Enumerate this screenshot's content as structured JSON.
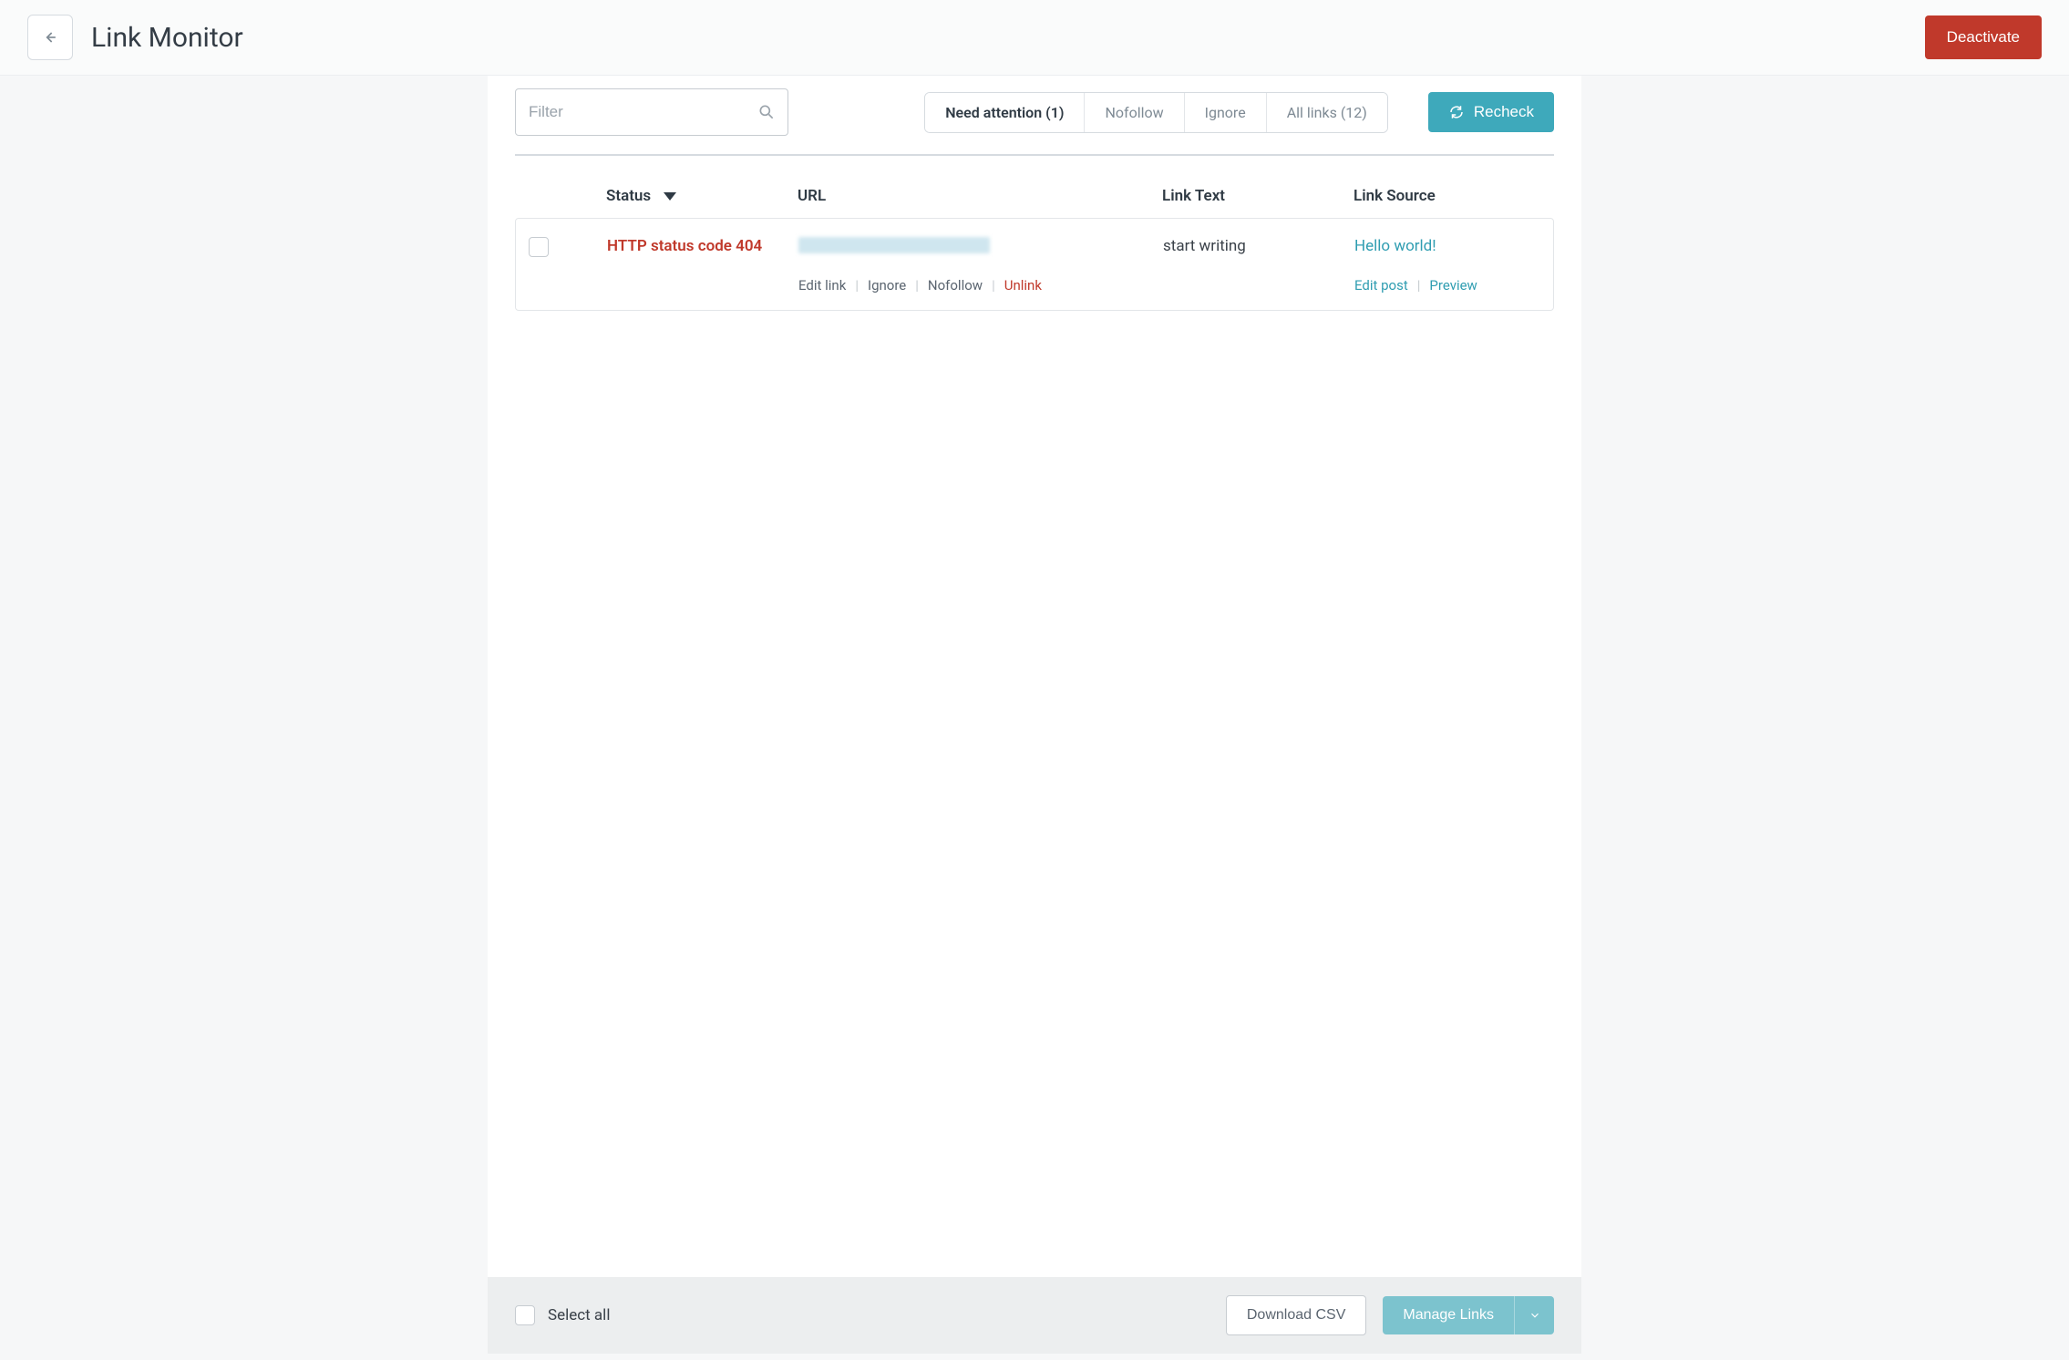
{
  "header": {
    "title": "Link Monitor",
    "deactivate_label": "Deactivate"
  },
  "toolbar": {
    "filter_placeholder": "Filter",
    "tabs": [
      {
        "label": "Need attention (1)",
        "active": true
      },
      {
        "label": "Nofollow",
        "active": false
      },
      {
        "label": "Ignore",
        "active": false
      },
      {
        "label": "All links (12)",
        "active": false
      }
    ],
    "recheck_label": "Recheck"
  },
  "table": {
    "columns": {
      "status": "Status",
      "url": "URL",
      "link_text": "Link Text",
      "link_source": "Link Source"
    },
    "rows": [
      {
        "status": "HTTP status code 404",
        "url_blurred": true,
        "link_text": "start writing",
        "link_source": "Hello world!",
        "actions": {
          "edit_link": "Edit link",
          "ignore": "Ignore",
          "nofollow": "Nofollow",
          "unlink": "Unlink"
        },
        "source_actions": {
          "edit_post": "Edit post",
          "preview": "Preview"
        }
      }
    ]
  },
  "footer": {
    "select_all_label": "Select all",
    "download_label": "Download CSV",
    "manage_label": "Manage Links"
  }
}
